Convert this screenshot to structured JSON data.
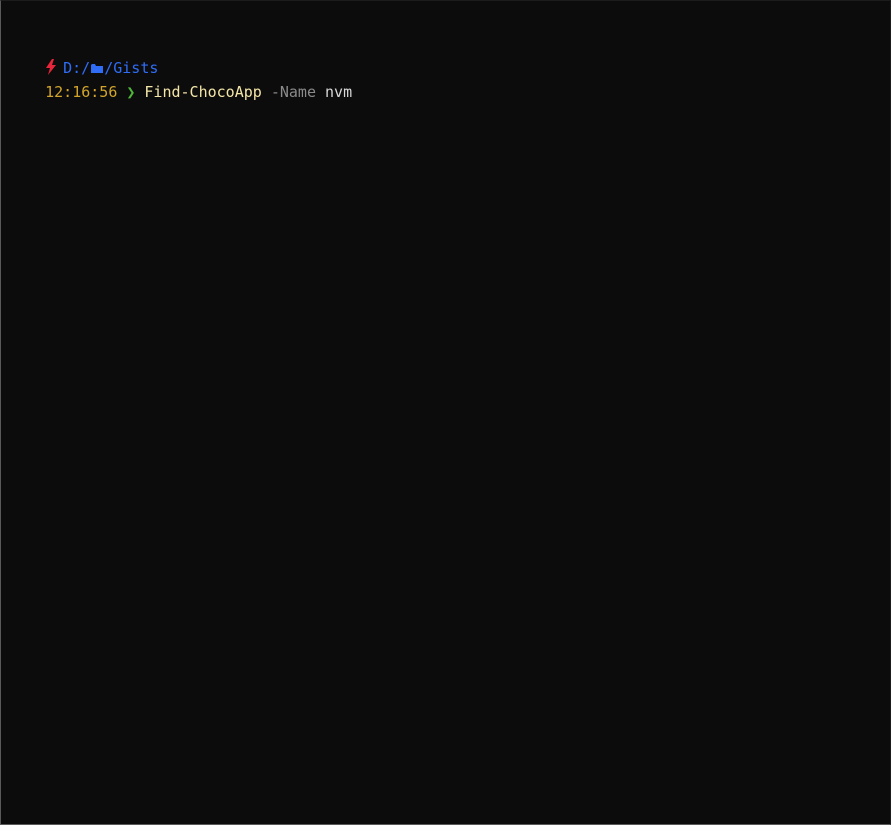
{
  "colors": {
    "background": "#0c0c0c",
    "bolt": "#e8253a",
    "path": "#2f6df6",
    "time": "#d2a52a",
    "chevron": "#4fb73a",
    "command": "#f4e6a8",
    "parameter": "#8a8a8a",
    "argument": "#d8d8d8"
  },
  "prompt": {
    "bolt_icon": "lightning-bolt-icon",
    "path_prefix": "D:/",
    "folder_icon": "folder-icon",
    "path_suffix": "/Gists",
    "time": "12:16:56",
    "chevron": "❯"
  },
  "command_line": {
    "command": "Find-ChocoApp",
    "parameter": "-Name",
    "argument": "nvm"
  }
}
